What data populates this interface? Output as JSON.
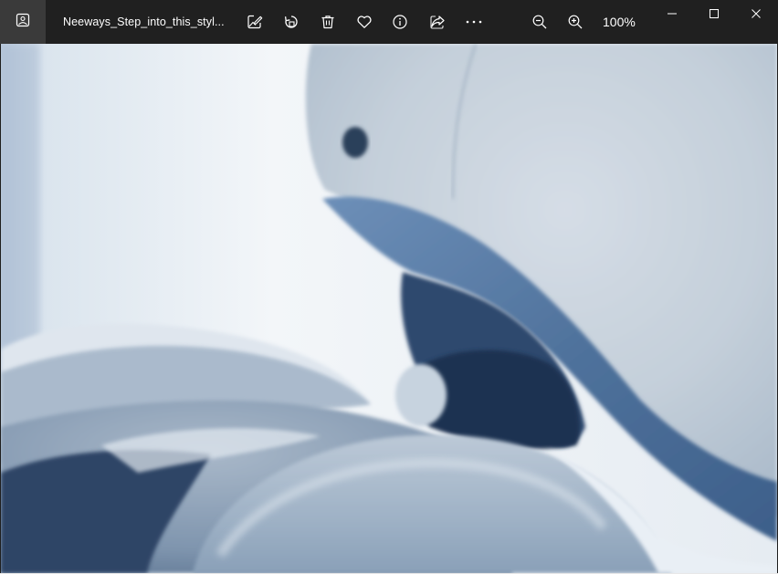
{
  "window": {
    "file_name": "Neeways_Step_into_this_styl...",
    "zoom_level": "100%"
  },
  "toolbar": {
    "icons": [
      "gallery-icon",
      "edit-image-icon",
      "rotate-icon",
      "delete-icon",
      "favorite-icon",
      "info-icon",
      "share-icon",
      "more-icon",
      "zoom-out-icon",
      "zoom-in-icon"
    ]
  },
  "window_controls": [
    "minimize-icon",
    "maximize-icon",
    "close-icon"
  ],
  "colors": {
    "titlebar": "#202020",
    "app_button": "#3a3a3a",
    "text": "#ffffff",
    "photo_dominant_blue": "#5b7fa8",
    "photo_white": "#eef3f7"
  }
}
